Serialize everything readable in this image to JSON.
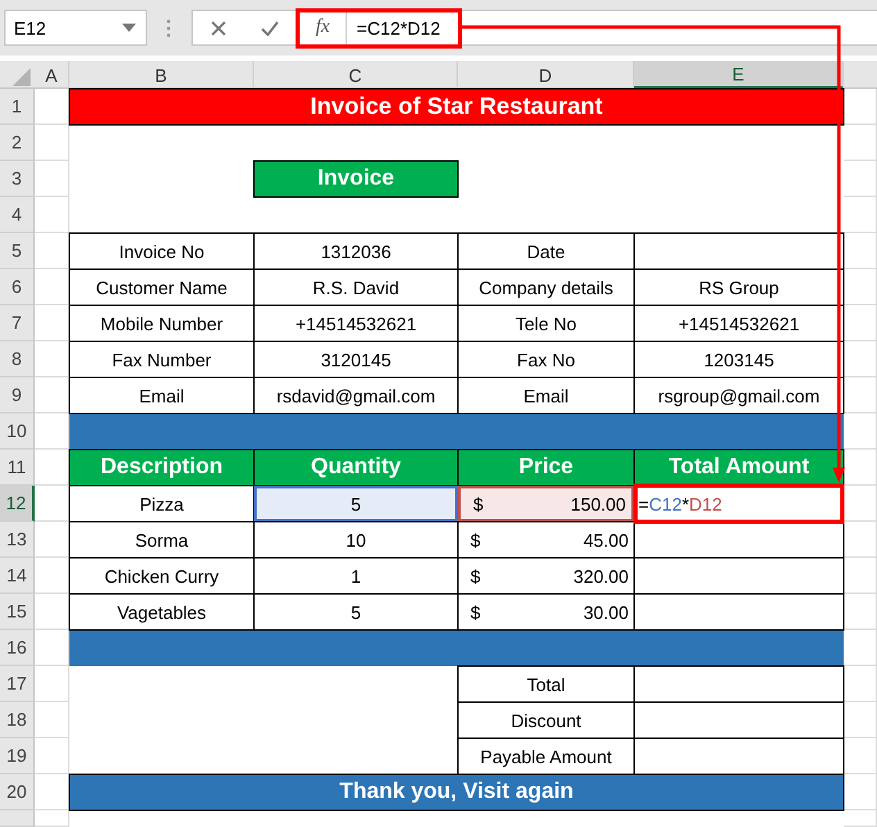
{
  "name_box": {
    "value": "E12"
  },
  "formula_bar": {
    "function_label": "fx",
    "value": "=C12*D12"
  },
  "columns": [
    {
      "label": "A",
      "selected": false
    },
    {
      "label": "B",
      "selected": false
    },
    {
      "label": "C",
      "selected": false
    },
    {
      "label": "D",
      "selected": false
    },
    {
      "label": "E",
      "selected": true
    }
  ],
  "rows": [
    {
      "number": "1",
      "selected": false,
      "kind": "title",
      "text": "Invoice of Star Restaurant"
    },
    {
      "number": "2",
      "selected": false,
      "kind": "empty"
    },
    {
      "number": "3",
      "selected": false,
      "kind": "subtitle",
      "text": "Invoice"
    },
    {
      "number": "4",
      "selected": false,
      "kind": "empty"
    },
    {
      "number": "5",
      "selected": false,
      "kind": "table",
      "cells": [
        {
          "text": "Invoice No"
        },
        {
          "text": "1312036"
        },
        {
          "text": "Date"
        },
        {}
      ]
    },
    {
      "number": "6",
      "selected": false,
      "kind": "table",
      "cells": [
        {
          "text": "Customer Name"
        },
        {
          "text": "R.S. David"
        },
        {
          "text": "Company details"
        },
        {
          "text": "RS Group"
        }
      ]
    },
    {
      "number": "7",
      "selected": false,
      "kind": "table",
      "cells": [
        {
          "text": "Mobile Number"
        },
        {
          "text": "+14514532621"
        },
        {
          "text": "Tele No"
        },
        {
          "text": "+14514532621"
        }
      ]
    },
    {
      "number": "8",
      "selected": false,
      "kind": "table",
      "cells": [
        {
          "text": "Fax Number"
        },
        {
          "text": "3120145"
        },
        {
          "text": "Fax No"
        },
        {
          "text": "1203145"
        }
      ]
    },
    {
      "number": "9",
      "selected": false,
      "kind": "table",
      "cells": [
        {
          "text": "Email"
        },
        {
          "text": "rsdavid@gmail.com"
        },
        {
          "text": "Email"
        },
        {
          "text": "rsgroup@gmail.com"
        }
      ]
    },
    {
      "number": "10",
      "selected": false,
      "kind": "band"
    },
    {
      "number": "11",
      "selected": false,
      "kind": "header",
      "cells": [
        {
          "text": "Description"
        },
        {
          "text": "Quantity"
        },
        {
          "text": "Price"
        },
        {
          "text": "Total Amount"
        }
      ]
    },
    {
      "number": "12",
      "selected": true,
      "kind": "item",
      "cells": [
        {
          "text": "Pizza"
        },
        {
          "text": "5",
          "color": "#4472c4"
        },
        {
          "currency": "$",
          "text": "150.00",
          "color": "#c0504d"
        },
        {
          "formula": [
            {
              "text": "=",
              "color": "#000000"
            },
            {
              "text": "C12",
              "color": "#4472c4"
            },
            {
              "text": "*",
              "color": "#000000"
            },
            {
              "text": "D12",
              "color": "#c0504d"
            }
          ]
        }
      ]
    },
    {
      "number": "13",
      "selected": false,
      "kind": "item",
      "cells": [
        {
          "text": "Sorma"
        },
        {
          "text": "10"
        },
        {
          "currency": "$",
          "text": "45.00"
        },
        {}
      ]
    },
    {
      "number": "14",
      "selected": false,
      "kind": "item",
      "cells": [
        {
          "text": "Chicken Curry"
        },
        {
          "text": "1"
        },
        {
          "currency": "$",
          "text": "320.00"
        },
        {}
      ]
    },
    {
      "number": "15",
      "selected": false,
      "kind": "item",
      "cells": [
        {
          "text": "Vagetables"
        },
        {
          "text": "5"
        },
        {
          "currency": "$",
          "text": "30.00"
        },
        {}
      ]
    },
    {
      "number": "16",
      "selected": false,
      "kind": "band"
    },
    {
      "number": "17",
      "selected": false,
      "kind": "summary",
      "text": "Total"
    },
    {
      "number": "18",
      "selected": false,
      "kind": "summary",
      "text": "Discount"
    },
    {
      "number": "19",
      "selected": false,
      "kind": "summary",
      "text": "Payable Amount"
    },
    {
      "number": "20",
      "selected": false,
      "kind": "footer",
      "text": "Thank you, Visit again"
    }
  ]
}
